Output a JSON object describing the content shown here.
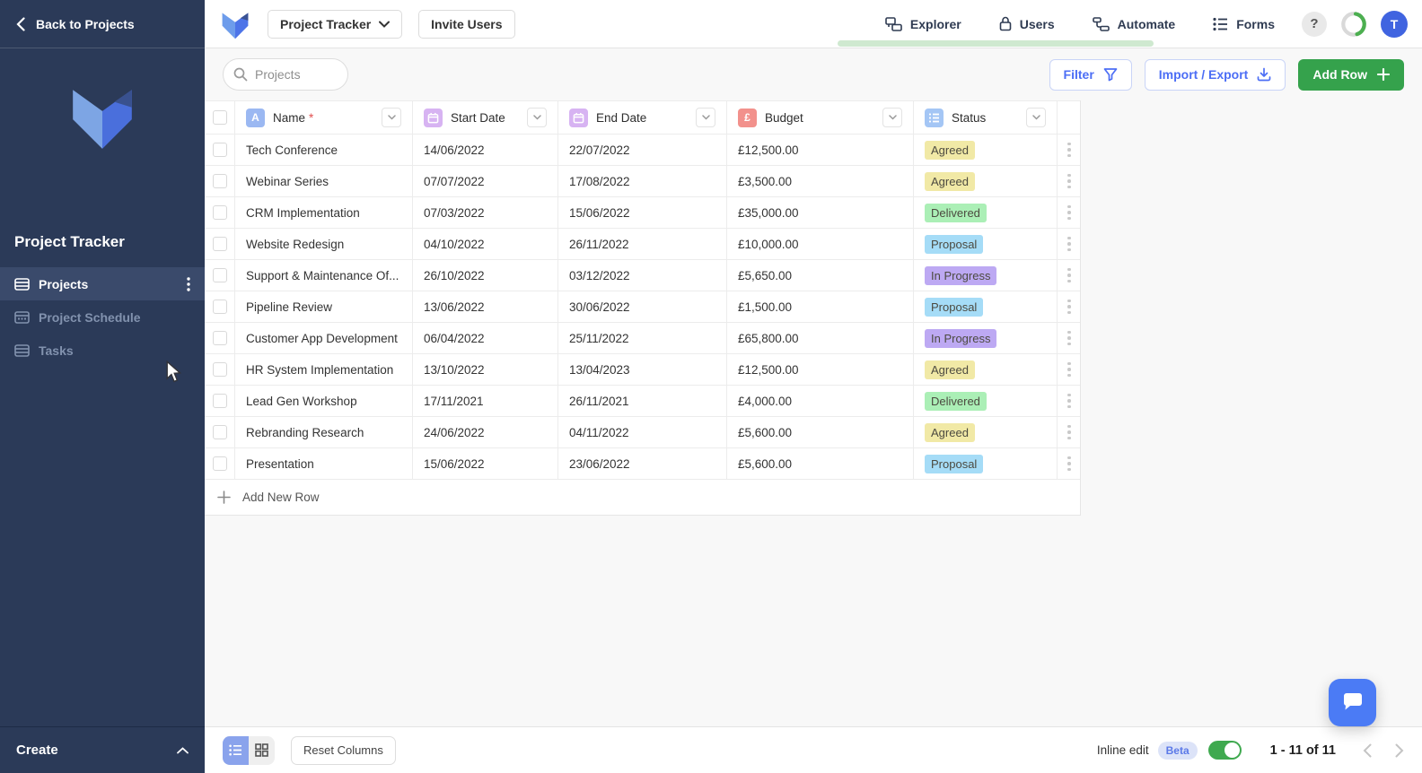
{
  "sidebar": {
    "back_label": "Back to Projects",
    "workspace_title": "Project Tracker",
    "items": [
      {
        "label": "Projects"
      },
      {
        "label": "Project Schedule"
      },
      {
        "label": "Tasks"
      }
    ],
    "create_label": "Create"
  },
  "header": {
    "workspace_button_label": "Project Tracker",
    "invite_button_label": "Invite Users",
    "nav": [
      {
        "label": "Explorer"
      },
      {
        "label": "Users"
      },
      {
        "label": "Automate"
      },
      {
        "label": "Forms"
      }
    ],
    "help_label": "?",
    "avatar_initial": "T"
  },
  "toolbar": {
    "search_placeholder": "Projects",
    "filter_label": "Filter",
    "import_export_label": "Import / Export",
    "add_row_label": "Add Row"
  },
  "table": {
    "columns": [
      {
        "label": "Name",
        "required_marker": "*"
      },
      {
        "label": "Start Date"
      },
      {
        "label": "End Date"
      },
      {
        "label": "Budget"
      },
      {
        "label": "Status"
      }
    ],
    "rows": [
      {
        "name": "Tech Conference",
        "start_date": "14/06/2022",
        "end_date": "22/07/2022",
        "budget": "£12,500.00",
        "status": "Agreed"
      },
      {
        "name": "Webinar Series",
        "start_date": "07/07/2022",
        "end_date": "17/08/2022",
        "budget": "£3,500.00",
        "status": "Agreed"
      },
      {
        "name": "CRM Implementation",
        "start_date": "07/03/2022",
        "end_date": "15/06/2022",
        "budget": "£35,000.00",
        "status": "Delivered"
      },
      {
        "name": "Website Redesign",
        "start_date": "04/10/2022",
        "end_date": "26/11/2022",
        "budget": "£10,000.00",
        "status": "Proposal"
      },
      {
        "name": "Support & Maintenance Of...",
        "start_date": "26/10/2022",
        "end_date": "03/12/2022",
        "budget": "£5,650.00",
        "status": "In Progress"
      },
      {
        "name": "Pipeline Review",
        "start_date": "13/06/2022",
        "end_date": "30/06/2022",
        "budget": "£1,500.00",
        "status": "Proposal"
      },
      {
        "name": "Customer App Development",
        "start_date": "06/04/2022",
        "end_date": "25/11/2022",
        "budget": "£65,800.00",
        "status": "In Progress"
      },
      {
        "name": "HR System Implementation",
        "start_date": "13/10/2022",
        "end_date": "13/04/2023",
        "budget": "£12,500.00",
        "status": "Agreed"
      },
      {
        "name": "Lead Gen Workshop",
        "start_date": "17/11/2021",
        "end_date": "26/11/2021",
        "budget": "£4,000.00",
        "status": "Delivered"
      },
      {
        "name": "Rebranding Research",
        "start_date": "24/06/2022",
        "end_date": "04/11/2022",
        "budget": "£5,600.00",
        "status": "Agreed"
      },
      {
        "name": "Presentation",
        "start_date": "15/06/2022",
        "end_date": "23/06/2022",
        "budget": "£5,600.00",
        "status": "Proposal"
      }
    ],
    "add_row_label": "Add New Row"
  },
  "status_colors": {
    "Agreed": "#f1e9a6",
    "Delivered": "#abefb6",
    "Proposal": "#a5dcf7",
    "In Progress": "#bda9f3"
  },
  "footer": {
    "reset_columns_label": "Reset Columns",
    "inline_edit_label": "Inline edit",
    "beta_label": "Beta",
    "range_label": "1 - 11 of 11"
  },
  "colors": {
    "accent_blue": "#4c6ef5",
    "add_row_green": "#35a24c",
    "toggle_green": "#3fa94f",
    "avatar_blue": "#4064e0",
    "chat_blue": "#4b7bf5",
    "name_icon_bg": "#9bb8f2",
    "date_icon_bg": "#d7b3f2",
    "budget_icon_bg": "#f2918c",
    "status_icon_bg": "#a4c6f5"
  }
}
